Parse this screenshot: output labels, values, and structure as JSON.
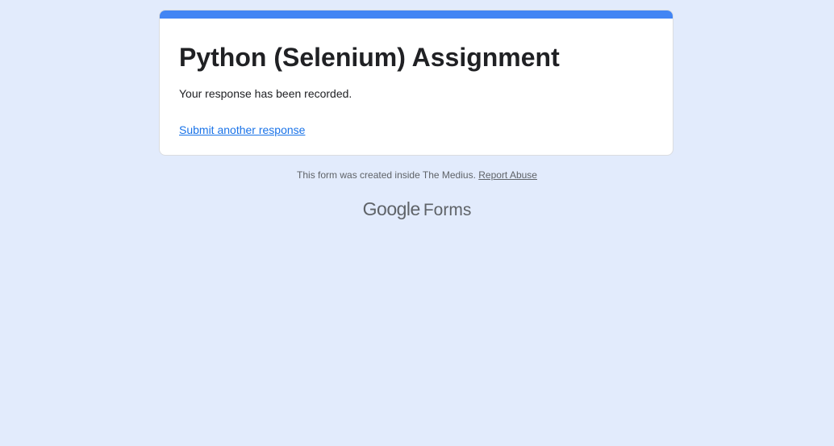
{
  "card": {
    "title": "Python (Selenium) Assignment",
    "message": "Your response has been recorded.",
    "submit_another_label": "Submit another response"
  },
  "footer": {
    "note": "This form was created inside The Medius.",
    "report_label": "Report Abuse"
  },
  "brand": {
    "google": "Google",
    "product": "Forms"
  },
  "colors": {
    "background": "#e2ebfc",
    "accent": "#4285f4",
    "link": "#1a73e8",
    "muted_text": "#5f6368"
  }
}
